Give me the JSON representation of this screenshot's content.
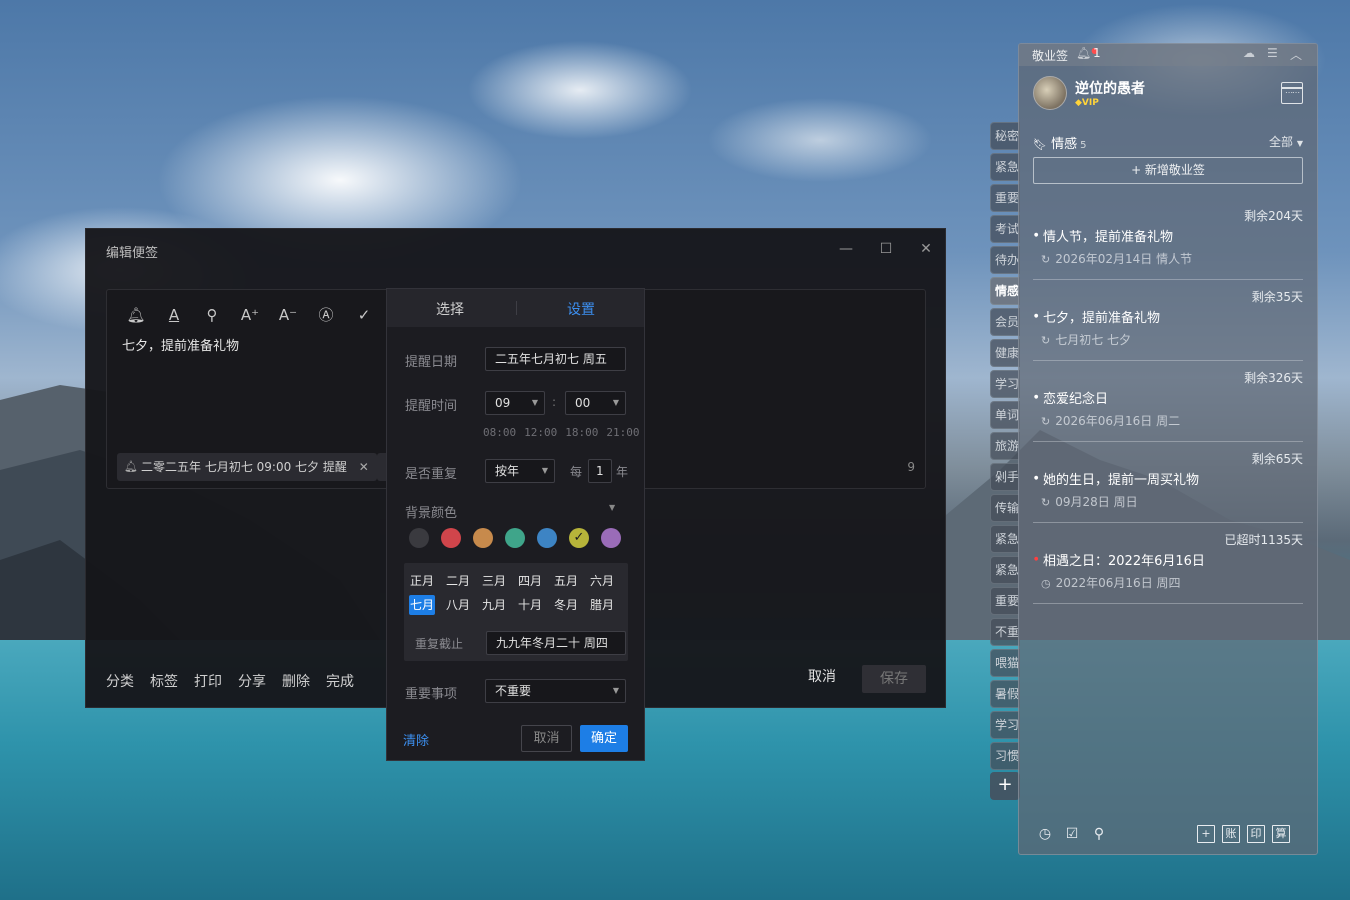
{
  "editor": {
    "title": "编辑便签",
    "controls": {
      "minimize": "—",
      "maximize": "☐",
      "close": "✕"
    },
    "content_text": "七夕，提前准备礼物",
    "reminder_chip": "二零二五年 七月初七 09:00 七夕 提醒",
    "char_count": "9",
    "footer": {
      "category": "分类",
      "tag": "标签",
      "print": "打印",
      "share": "分享",
      "delete": "删除",
      "done": "完成",
      "cancel": "取消",
      "save": "保存"
    }
  },
  "popup": {
    "tab_select": "选择",
    "tab_settings": "设置",
    "remind_date_label": "提醒日期",
    "remind_date_value": "二五年七月初七  周五",
    "remind_time_label": "提醒时间",
    "hour": "09",
    "minute": "00",
    "colon": ":",
    "quick_times": [
      "08:00",
      "12:00",
      "18:00",
      "21:00"
    ],
    "repeat_label": "是否重复",
    "repeat_value": "按年",
    "every_label": "每",
    "every_value": "1",
    "unit_label": "年",
    "bg_color_label": "背景颜色",
    "colors": [
      "#3a3a3f",
      "#d0454b",
      "#c78a4c",
      "#3fa58a",
      "#3d84c4",
      "#b7b43a",
      "#9a6cb8"
    ],
    "selected_color_index": 5,
    "months_row1": [
      "正月",
      "二月",
      "三月",
      "四月",
      "五月",
      "六月"
    ],
    "months_row2": [
      "七月",
      "八月",
      "九月",
      "十月",
      "冬月",
      "腊月"
    ],
    "selected_month": "七月",
    "repeat_until_label": "重复截止",
    "repeat_until_value": "九九年冬月二十  周四",
    "important_label": "重要事项",
    "important_value": "不重要",
    "clear": "清除",
    "cancel": "取消",
    "ok": "确定"
  },
  "side_tabs": [
    "秘密",
    "紧急",
    "重要",
    "考试",
    "待办",
    "情感",
    "会员",
    "健康",
    "学习",
    "单词",
    "旅游",
    "剁手",
    "传输",
    "紧急",
    "紧急",
    "重要",
    "不重",
    "喂猫",
    "暑假",
    "学习",
    "习惯"
  ],
  "active_tab": "情感",
  "add_tab": "+",
  "panel": {
    "app_name": "敬业签",
    "notif_count": "1",
    "username": "逆位的愚者",
    "vip": "VIP",
    "category": "情感",
    "category_count": "5",
    "filter": "全部",
    "new_note": "+ 新增敬业签",
    "notes": [
      {
        "remain": "剩余204天",
        "title": "情人节，提前准备礼物",
        "sub": "2026年02月14日 情人节",
        "overdue": false
      },
      {
        "remain": "剩余35天",
        "title": "七夕，提前准备礼物",
        "sub": "七月初七 七夕",
        "overdue": false
      },
      {
        "remain": "剩余326天",
        "title": "恋爱纪念日",
        "sub": "2026年06月16日 周二",
        "overdue": false
      },
      {
        "remain": "剩余65天",
        "title": "她的生日，提前一周买礼物",
        "sub": "09月28日 周日",
        "overdue": false
      },
      {
        "remain": "已超时1135天",
        "title": "相遇之日：2022年6月16日",
        "sub": "2022年06月16日 周四",
        "overdue": true
      }
    ],
    "footer_icons": [
      "clock-icon",
      "checklist-icon",
      "search-icon"
    ],
    "footer_boxes": [
      "+",
      "账",
      "印",
      "算"
    ]
  }
}
